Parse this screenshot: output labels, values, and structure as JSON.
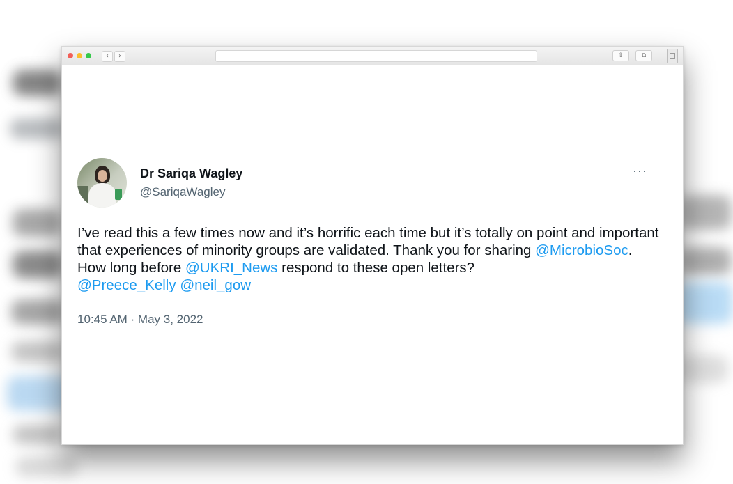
{
  "browser": {
    "back_label": "‹",
    "forward_label": "›",
    "share_icon": "⇧",
    "tabs_icon": "⧉"
  },
  "tweet": {
    "author_name": "Dr Sariqa Wagley",
    "handle": "@SariqaWagley",
    "more_label": "···",
    "text_1": "I’ve read this a few times now and it’s horrific each time but it’s totally on point and important that experiences of minority groups are validated. Thank you for sharing ",
    "mention_1": "@MicrobioSoc",
    "text_2": ". How long before ",
    "mention_2": "@UKRI_News",
    "text_3": " respond to these open letters?",
    "mention_3": "@Preece_Kelly",
    "mention_4": "@neil_gow",
    "timestamp": "10:45 AM · May 3, 2022"
  },
  "colors": {
    "mention": "#1d9bf0",
    "text": "#0f1419",
    "secondary": "#536471"
  }
}
